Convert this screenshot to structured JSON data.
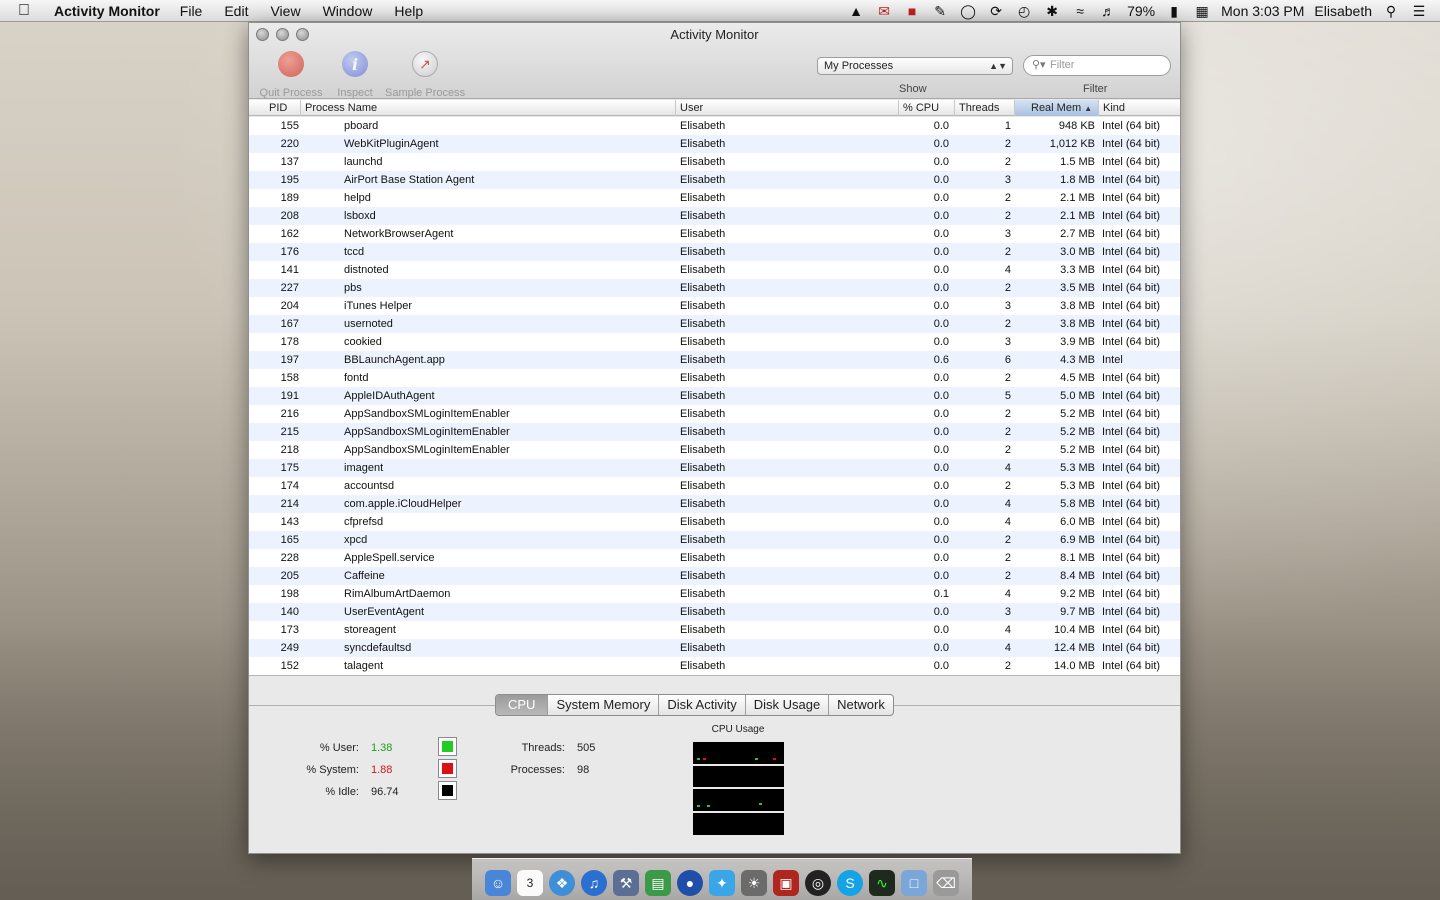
{
  "menubar": {
    "app_name": "Activity Monitor",
    "menus": [
      "File",
      "Edit",
      "View",
      "Window",
      "Help"
    ],
    "battery": "79%",
    "clock": "Mon 3:03 PM",
    "user": "Elisabeth"
  },
  "window": {
    "title": "Activity Monitor",
    "toolbar": {
      "quit_label": "Quit Process",
      "inspect_label": "Inspect",
      "sample_label": "Sample Process"
    },
    "show_select": "My Processes",
    "show_label": "Show",
    "filter_placeholder": "Filter",
    "filter_label": "Filter"
  },
  "table": {
    "columns": [
      "PID",
      "Process Name",
      "User",
      "% CPU",
      "Threads",
      "Real Mem",
      "Kind"
    ],
    "sorted_column": "Real Mem",
    "rows": [
      [
        "155",
        "pboard",
        "Elisabeth",
        "0.0",
        "1",
        "948 KB",
        "Intel (64 bit)"
      ],
      [
        "220",
        "WebKitPluginAgent",
        "Elisabeth",
        "0.0",
        "2",
        "1,012 KB",
        "Intel (64 bit)"
      ],
      [
        "137",
        "launchd",
        "Elisabeth",
        "0.0",
        "2",
        "1.5 MB",
        "Intel (64 bit)"
      ],
      [
        "195",
        "AirPort Base Station Agent",
        "Elisabeth",
        "0.0",
        "3",
        "1.8 MB",
        "Intel (64 bit)"
      ],
      [
        "189",
        "helpd",
        "Elisabeth",
        "0.0",
        "2",
        "2.1 MB",
        "Intel (64 bit)"
      ],
      [
        "208",
        "lsboxd",
        "Elisabeth",
        "0.0",
        "2",
        "2.1 MB",
        "Intel (64 bit)"
      ],
      [
        "162",
        "NetworkBrowserAgent",
        "Elisabeth",
        "0.0",
        "3",
        "2.7 MB",
        "Intel (64 bit)"
      ],
      [
        "176",
        "tccd",
        "Elisabeth",
        "0.0",
        "2",
        "3.0 MB",
        "Intel (64 bit)"
      ],
      [
        "141",
        "distnoted",
        "Elisabeth",
        "0.0",
        "4",
        "3.3 MB",
        "Intel (64 bit)"
      ],
      [
        "227",
        "pbs",
        "Elisabeth",
        "0.0",
        "2",
        "3.5 MB",
        "Intel (64 bit)"
      ],
      [
        "204",
        "iTunes Helper",
        "Elisabeth",
        "0.0",
        "3",
        "3.8 MB",
        "Intel (64 bit)"
      ],
      [
        "167",
        "usernoted",
        "Elisabeth",
        "0.0",
        "2",
        "3.8 MB",
        "Intel (64 bit)"
      ],
      [
        "178",
        "cookied",
        "Elisabeth",
        "0.0",
        "3",
        "3.9 MB",
        "Intel (64 bit)"
      ],
      [
        "197",
        "BBLaunchAgent.app",
        "Elisabeth",
        "0.6",
        "6",
        "4.3 MB",
        "Intel"
      ],
      [
        "158",
        "fontd",
        "Elisabeth",
        "0.0",
        "2",
        "4.5 MB",
        "Intel (64 bit)"
      ],
      [
        "191",
        "AppleIDAuthAgent",
        "Elisabeth",
        "0.0",
        "5",
        "5.0 MB",
        "Intel (64 bit)"
      ],
      [
        "216",
        "AppSandboxSMLoginItemEnabler",
        "Elisabeth",
        "0.0",
        "2",
        "5.2 MB",
        "Intel (64 bit)"
      ],
      [
        "215",
        "AppSandboxSMLoginItemEnabler",
        "Elisabeth",
        "0.0",
        "2",
        "5.2 MB",
        "Intel (64 bit)"
      ],
      [
        "218",
        "AppSandboxSMLoginItemEnabler",
        "Elisabeth",
        "0.0",
        "2",
        "5.2 MB",
        "Intel (64 bit)"
      ],
      [
        "175",
        "imagent",
        "Elisabeth",
        "0.0",
        "4",
        "5.3 MB",
        "Intel (64 bit)"
      ],
      [
        "174",
        "accountsd",
        "Elisabeth",
        "0.0",
        "2",
        "5.3 MB",
        "Intel (64 bit)"
      ],
      [
        "214",
        "com.apple.iCloudHelper",
        "Elisabeth",
        "0.0",
        "4",
        "5.8 MB",
        "Intel (64 bit)"
      ],
      [
        "143",
        "cfprefsd",
        "Elisabeth",
        "0.0",
        "4",
        "6.0 MB",
        "Intel (64 bit)"
      ],
      [
        "165",
        "xpcd",
        "Elisabeth",
        "0.0",
        "2",
        "6.9 MB",
        "Intel (64 bit)"
      ],
      [
        "228",
        "AppleSpell.service",
        "Elisabeth",
        "0.0",
        "2",
        "8.1 MB",
        "Intel (64 bit)"
      ],
      [
        "205",
        "Caffeine",
        "Elisabeth",
        "0.0",
        "2",
        "8.4 MB",
        "Intel (64 bit)"
      ],
      [
        "198",
        "RimAlbumArtDaemon",
        "Elisabeth",
        "0.1",
        "4",
        "9.2 MB",
        "Intel (64 bit)"
      ],
      [
        "140",
        "UserEventAgent",
        "Elisabeth",
        "0.0",
        "3",
        "9.7 MB",
        "Intel (64 bit)"
      ],
      [
        "173",
        "storeagent",
        "Elisabeth",
        "0.0",
        "4",
        "10.4 MB",
        "Intel (64 bit)"
      ],
      [
        "249",
        "syncdefaultsd",
        "Elisabeth",
        "0.0",
        "4",
        "12.4 MB",
        "Intel (64 bit)"
      ],
      [
        "152",
        "talagent",
        "Elisabeth",
        "0.0",
        "2",
        "14.0 MB",
        "Intel (64 bit)"
      ]
    ]
  },
  "tabs": [
    "CPU",
    "System Memory",
    "Disk Activity",
    "Disk Usage",
    "Network"
  ],
  "active_tab": "CPU",
  "cpu": {
    "user_label": "% User:",
    "user_value": "1.38",
    "system_label": "% System:",
    "system_value": "1.88",
    "idle_label": "% Idle:",
    "idle_value": "96.74",
    "threads_label": "Threads:",
    "threads_value": "505",
    "processes_label": "Processes:",
    "processes_value": "98",
    "graph_title": "CPU Usage",
    "colors": {
      "user": "#22cc22",
      "system": "#dd1111",
      "idle": "#000000"
    }
  },
  "dock": {
    "items": [
      "finder-icon",
      "calendar-icon",
      "safari-icon",
      "itunes-icon",
      "xcode-icon",
      "numbers-icon",
      "browser-icon",
      "twitter-icon",
      "iphoto-icon",
      "photo-booth-icon",
      "aperture-icon",
      "skype-icon",
      "activity-monitor-icon",
      "folder-icon",
      "trash-icon"
    ],
    "calendar_day": "3"
  }
}
